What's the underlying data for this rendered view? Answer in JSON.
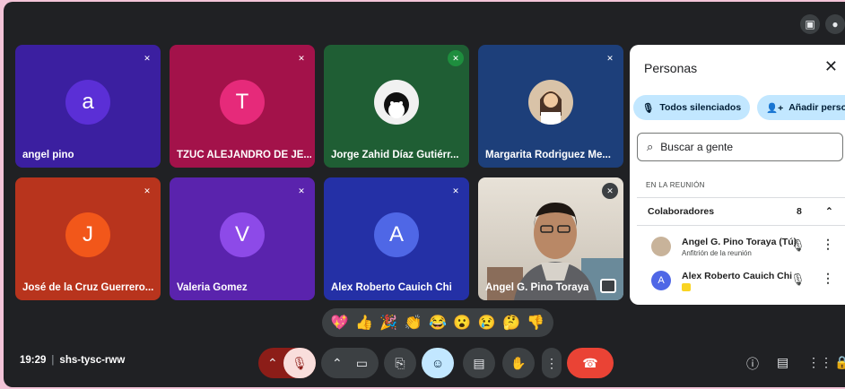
{
  "topbar": {
    "icons": [
      "no-camera-icon",
      "account-icon"
    ]
  },
  "tiles": [
    {
      "name": "angel pino",
      "initial": "a",
      "bg": "#3b1fa0",
      "avatar_color": "#5b2fd6"
    },
    {
      "name": "TZUC ALEJANDRO DE JE...",
      "initial": "T",
      "bg": "#a3124a",
      "avatar_color": "#e62a7a"
    },
    {
      "name": "Jorge Zahid Díaz Gutiérr...",
      "initial": "",
      "bg": "#1f5e34"
    },
    {
      "name": "Margarita Rodriguez Me...",
      "initial": "",
      "bg": "#1d3f7a"
    },
    {
      "name": "José de la Cruz Guerrero...",
      "initial": "J",
      "bg": "#b8341d",
      "avatar_color": "#f2571a"
    },
    {
      "name": "Valeria Gomez",
      "initial": "V",
      "bg": "#5a23ad",
      "avatar_color": "#8d4ae8"
    },
    {
      "name": "Alex Roberto Cauich Chi",
      "initial": "A",
      "bg": "#2430a6",
      "avatar_color": "#4f67e6"
    },
    {
      "name": "Angel G. Pino Toraya",
      "initial": "",
      "bg": "#d8d2c8"
    }
  ],
  "panel": {
    "title": "Personas",
    "mute_all": "Todos silenciados",
    "add_people": "Añadir persona",
    "search_placeholder": "Buscar a gente",
    "section_label": "EN LA REUNIÓN",
    "group_label": "Colaboradores",
    "group_count": "8",
    "participants": [
      {
        "name": "Angel G. Pino Toraya (Tú)",
        "role": "Anfitrión de la reunión"
      },
      {
        "name": "Alex Roberto Cauich Chi",
        "role": ""
      }
    ]
  },
  "reactions": [
    "💖",
    "👍",
    "🎉",
    "👏",
    "😂",
    "😮",
    "😢",
    "🤔",
    "👎"
  ],
  "bottom": {
    "time": "19:29",
    "code": "shs-tysc-rww"
  },
  "colors": {
    "hangup": "#ea4335",
    "mute_active": "#f9dedc",
    "accent": "#c2e7ff"
  }
}
